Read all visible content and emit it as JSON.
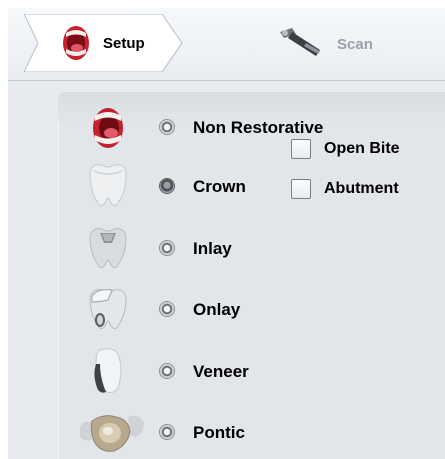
{
  "workflow": {
    "steps": [
      {
        "label": "Setup",
        "icon": "mouth-icon",
        "state": "active"
      },
      {
        "label": "Scan",
        "icon": "scanner-wand-icon",
        "state": "disabled"
      }
    ]
  },
  "restoration_types": [
    {
      "label": "Non Restorative",
      "icon": "mouth-icon",
      "selected": false
    },
    {
      "label": "Crown",
      "icon": "crown-tooth-icon",
      "selected": true
    },
    {
      "label": "Inlay",
      "icon": "inlay-tooth-icon",
      "selected": false
    },
    {
      "label": "Onlay",
      "icon": "onlay-tooth-icon",
      "selected": false
    },
    {
      "label": "Veneer",
      "icon": "veneer-tooth-icon",
      "selected": false
    },
    {
      "label": "Pontic",
      "icon": "pontic-bridge-icon",
      "selected": false
    }
  ],
  "options": {
    "open_bite": {
      "label": "Open Bite",
      "checked": false
    },
    "abutment": {
      "label": "Abutment",
      "checked": false
    }
  },
  "colors": {
    "accent_red": "#d8283a",
    "disabled_text": "#9aa1a9",
    "panel_bg": "#e2e5e9"
  }
}
